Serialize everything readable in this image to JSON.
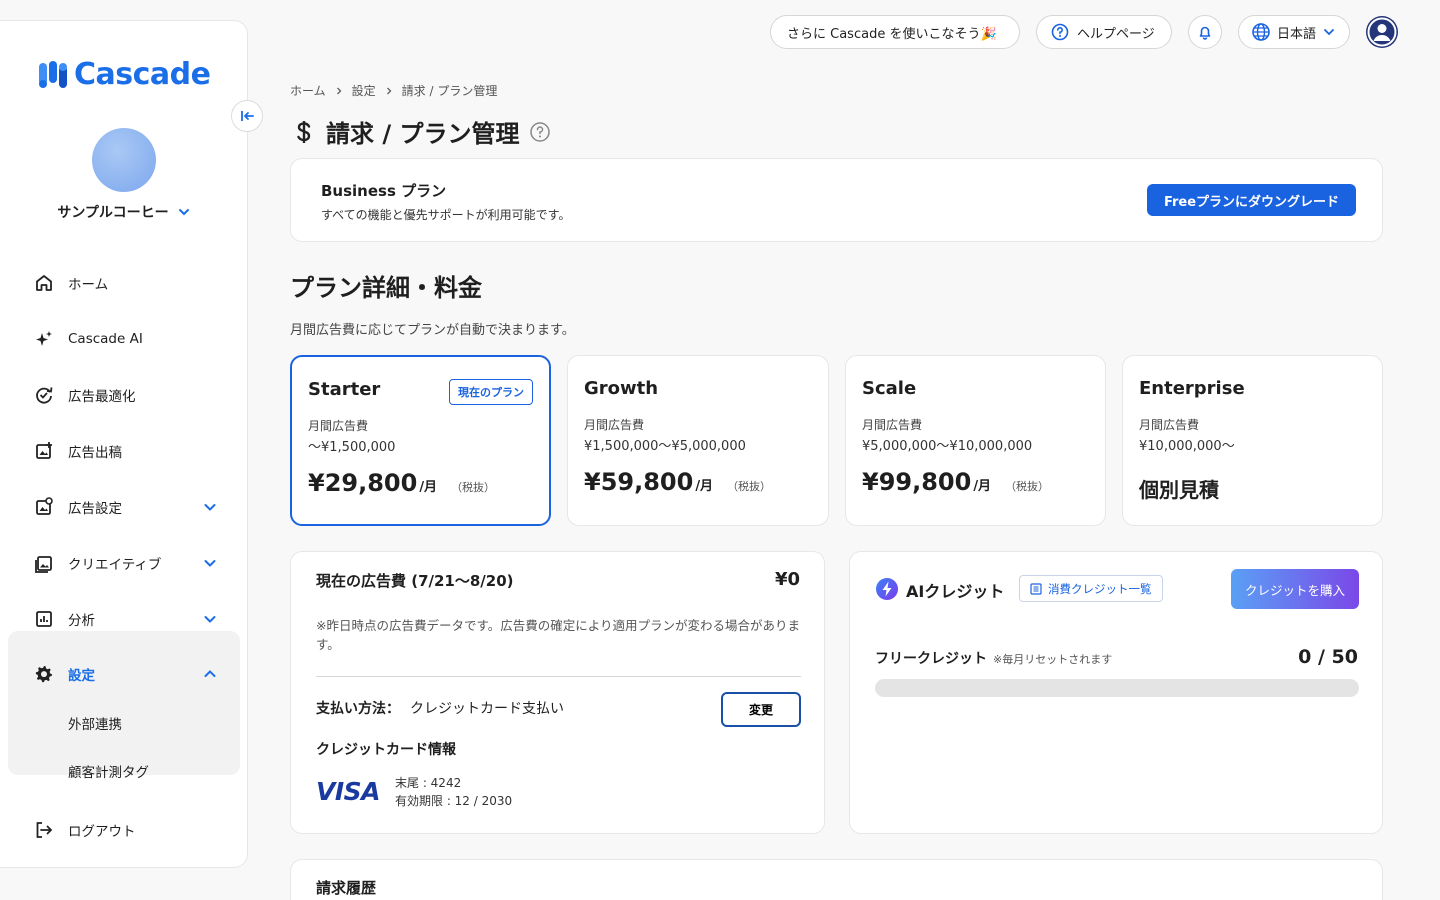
{
  "app": {
    "logo_text": "Cascade"
  },
  "topbar": {
    "promo": "さらに Cascade を使いこなそう🎉",
    "help": "ヘルプページ",
    "language": "日本語"
  },
  "sidebar": {
    "account_name": "サンプルコーヒー",
    "items": [
      {
        "label": "ホーム",
        "icon": "home-icon"
      },
      {
        "label": "Cascade AI",
        "icon": "sparkle-icon"
      },
      {
        "label": "広告最適化",
        "icon": "optimize-icon"
      },
      {
        "label": "広告出稿",
        "icon": "ad-publish-icon"
      },
      {
        "label": "広告設定",
        "icon": "ad-settings-icon"
      },
      {
        "label": "クリエイティブ",
        "icon": "image-icon"
      },
      {
        "label": "分析",
        "icon": "chart-icon"
      },
      {
        "label": "設定",
        "icon": "gear-icon"
      }
    ],
    "sub_items": [
      "外部連携",
      "顧客計測タグ"
    ],
    "logout": "ログアウト"
  },
  "breadcrumb": [
    "ホーム",
    "設定",
    "請求 / プラン管理"
  ],
  "page_title": "請求 / プラン管理",
  "current_plan": {
    "name": "Business プラン",
    "desc": "すべての機能と優先サポートが利用可能です。",
    "downgrade_button": "Freeプランにダウングレード"
  },
  "plans_section": {
    "title": "プラン詳細・料金",
    "desc": "月間広告費に応じてプランが自動で決まります。",
    "current_badge": "現在のプラン",
    "spend_label": "月間広告費",
    "unit": "/月",
    "tax": "（税抜）",
    "plans": [
      {
        "name": "Starter",
        "range": "〜¥1,500,000",
        "price": "¥29,800"
      },
      {
        "name": "Growth",
        "range": "¥1,500,000〜¥5,000,000",
        "price": "¥59,800"
      },
      {
        "name": "Scale",
        "range": "¥5,000,000〜¥10,000,000",
        "price": "¥99,800"
      },
      {
        "name": "Enterprise",
        "range": "¥10,000,000〜",
        "price": "個別見積"
      }
    ]
  },
  "spend_card": {
    "title": "現在の広告費 (7/21〜8/20)",
    "amount": "¥0",
    "note": "※昨日時点の広告費データです。広告費の確定により適用プランが変わる場合があります。",
    "payment_label": "支払い方法：",
    "payment_value": "クレジットカード支払い",
    "change_button": "変更",
    "card_info_title": "クレジットカード情報",
    "card_brand": "VISA",
    "card_last4": "末尾 : 4242",
    "card_expiry": "有効期限 : 12 / 2030"
  },
  "credit_card": {
    "title": "AIクレジット",
    "list_button": "消費クレジット一覧",
    "buy_button": "クレジットを購入",
    "free_label": "フリークレジット",
    "free_note": "※毎月リセットされます",
    "usage": "0 / 50",
    "progress_fraction": 0
  },
  "billing_history": {
    "title": "請求履歴"
  }
}
